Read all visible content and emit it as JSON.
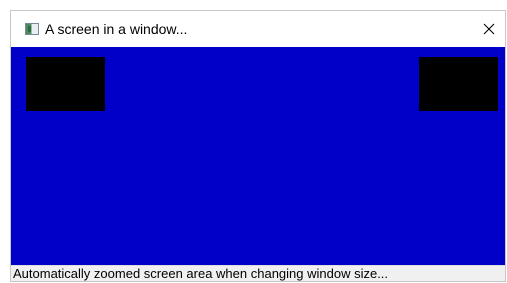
{
  "window": {
    "title": "A screen in a window...",
    "app_icon": "window-app-icon",
    "close_icon": "close-icon"
  },
  "screen": {
    "background_color": "#0000c8",
    "block_color": "#000000"
  },
  "statusbar": {
    "text": "Automatically zoomed screen area when changing window size..."
  }
}
